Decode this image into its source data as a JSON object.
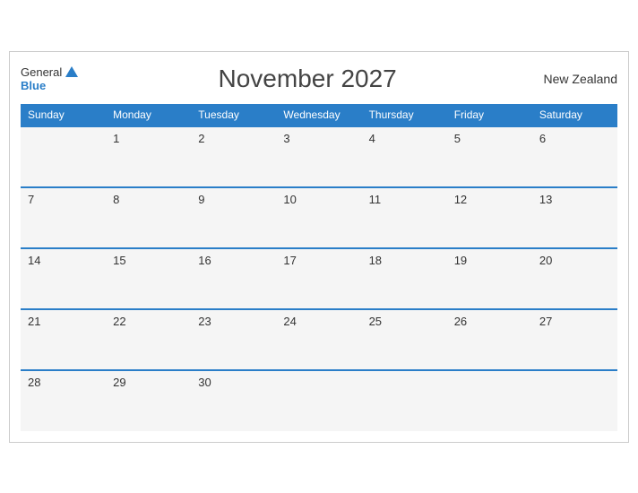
{
  "header": {
    "logo_general": "General",
    "logo_blue": "Blue",
    "month_title": "November 2027",
    "country": "New Zealand"
  },
  "days_of_week": [
    "Sunday",
    "Monday",
    "Tuesday",
    "Wednesday",
    "Thursday",
    "Friday",
    "Saturday"
  ],
  "weeks": [
    [
      "",
      "1",
      "2",
      "3",
      "4",
      "5",
      "6"
    ],
    [
      "7",
      "8",
      "9",
      "10",
      "11",
      "12",
      "13"
    ],
    [
      "14",
      "15",
      "16",
      "17",
      "18",
      "19",
      "20"
    ],
    [
      "21",
      "22",
      "23",
      "24",
      "25",
      "26",
      "27"
    ],
    [
      "28",
      "29",
      "30",
      "",
      "",
      "",
      ""
    ]
  ]
}
